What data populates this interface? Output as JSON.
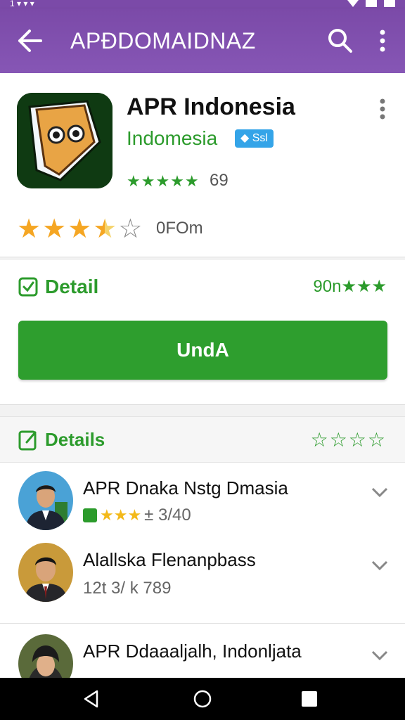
{
  "status_bar": {
    "left_text": "1 ▾ ▾ ▾"
  },
  "app_bar": {
    "title": "APÐDOMAIDNAZ"
  },
  "app": {
    "name": "APR Indonesia",
    "developer": "Indomesia",
    "badge": "Ssl",
    "small_stars": "★★★★★",
    "small_rating_count": "69",
    "rating_value": 3.5,
    "rating_label": "0FOm",
    "colors": {
      "accent_green": "#2c9b2c",
      "header_purple": "#7b4aa8",
      "star_orange": "#f5a623"
    }
  },
  "detail": {
    "title": "Detail",
    "right_text": "90n★★★",
    "button_label": "UndA"
  },
  "details": {
    "title": "Details",
    "stars": "☆☆☆☆"
  },
  "list": [
    {
      "title": "APR Dnaka Nstg Dmasia",
      "stars": "★★★",
      "subtitle": "± 3/40",
      "has_badge": true
    },
    {
      "title": "Alallska Flenanpbass",
      "stars": "",
      "subtitle": "12t 3/ k 789",
      "has_badge": false
    },
    {
      "title": "APR Ddaaaljalh, Indonljata",
      "stars": "",
      "subtitle": "",
      "has_badge": false
    }
  ],
  "icons": [
    "back-icon",
    "search-icon",
    "more-vert-icon",
    "check-icon",
    "edit-icon",
    "chevron-down-icon",
    "nav-back-icon",
    "nav-home-icon",
    "nav-recents-icon"
  ]
}
